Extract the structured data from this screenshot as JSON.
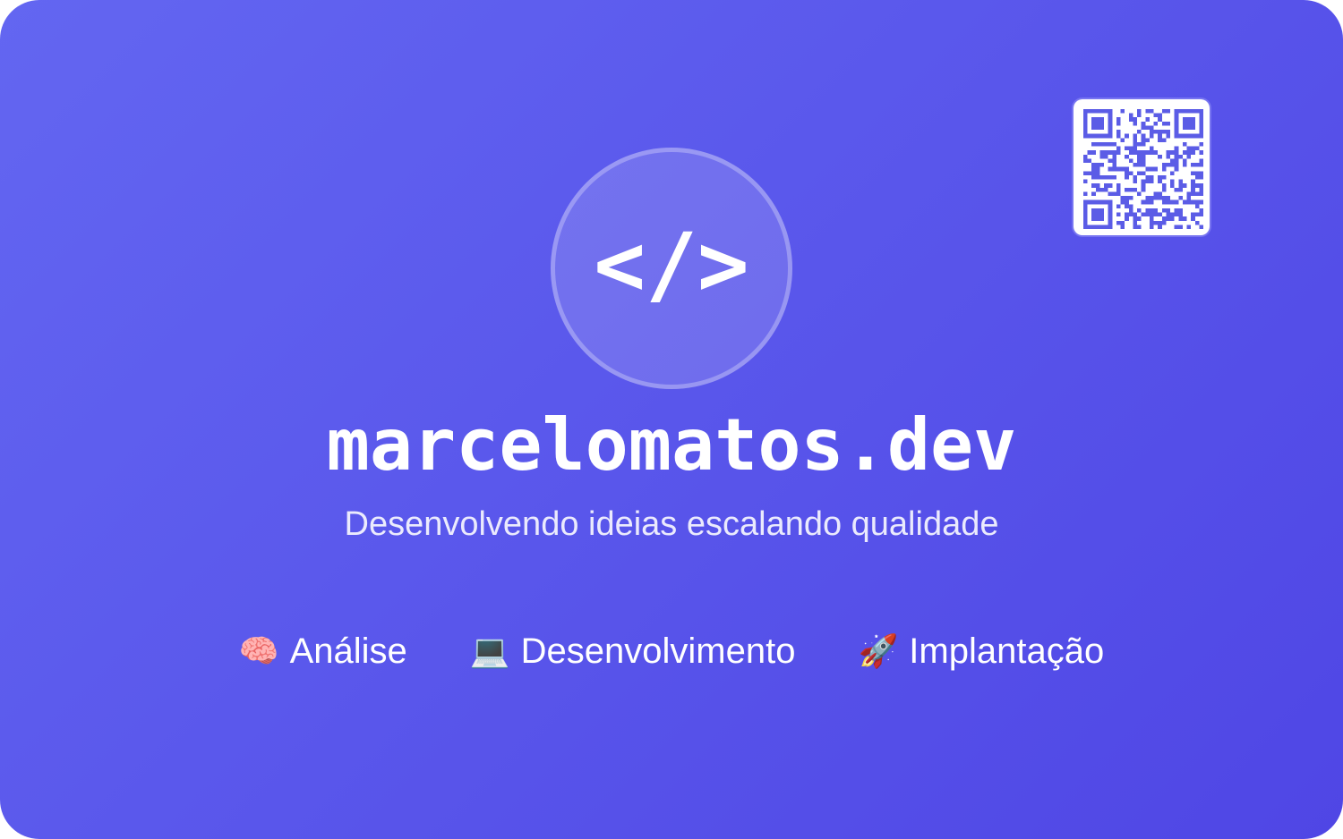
{
  "card": {
    "logo_code": "</>",
    "title": "marcelomatos.dev",
    "tagline": "Desenvolvendo ideias escalando qualidade"
  },
  "features": [
    {
      "icon": "brain-icon",
      "glyph": "🧠",
      "label": "Análise"
    },
    {
      "icon": "laptop-icon",
      "glyph": "💻",
      "label": "Desenvolvimento"
    },
    {
      "icon": "rocket-icon",
      "glyph": "🚀",
      "label": "Implantação"
    }
  ],
  "qr_code": {
    "icon": "qr-code-icon"
  },
  "colors": {
    "gradient_start": "#6366f1",
    "gradient_end": "#4f46e5",
    "qr_foreground": "#5b5ce6",
    "text": "#ffffff"
  }
}
